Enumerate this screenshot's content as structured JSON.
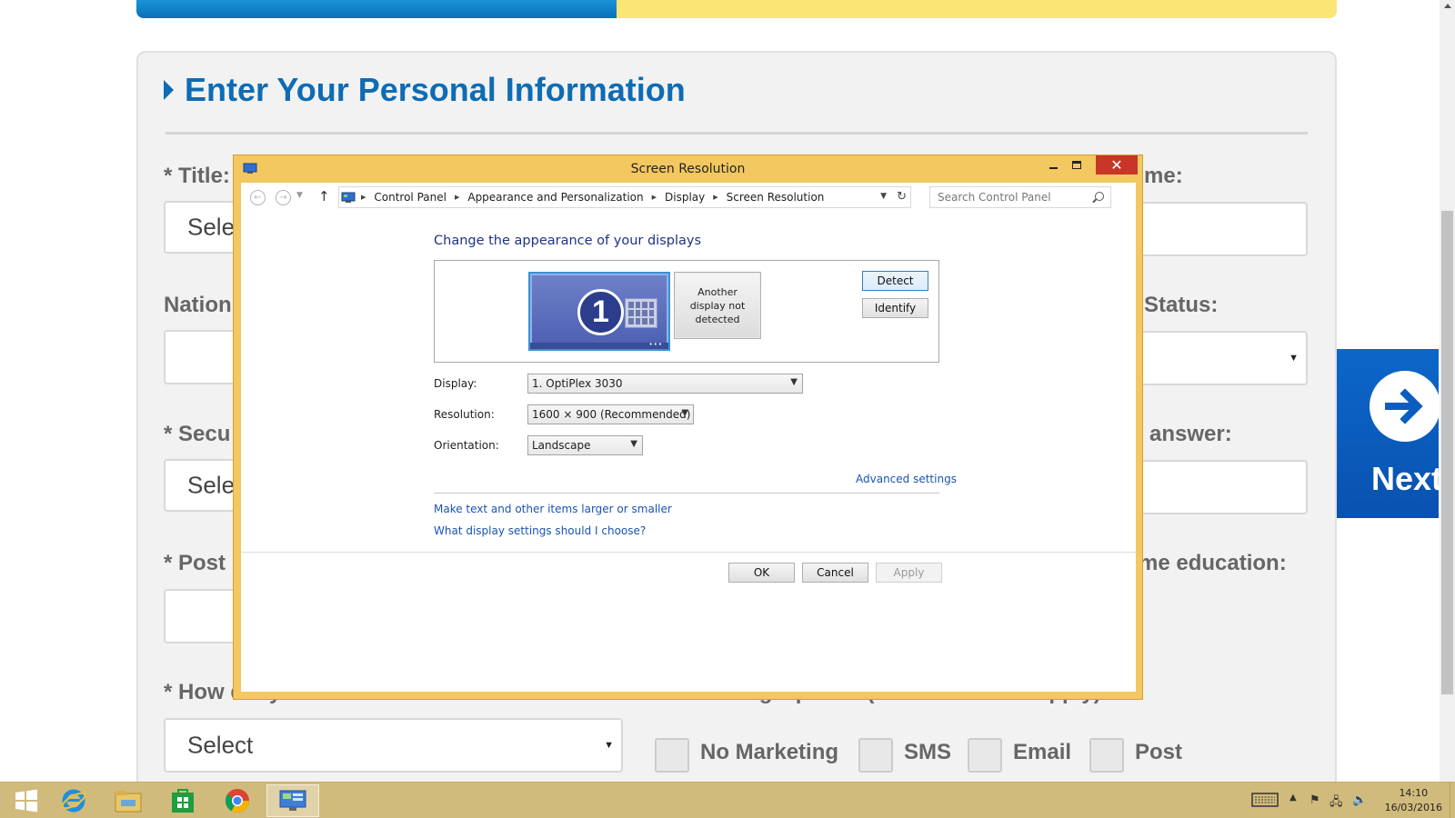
{
  "page": {
    "form": {
      "progress": 0.4,
      "section_title": "Enter Your Personal Information",
      "labels": {
        "title": "* Title:",
        "name_right": "me:",
        "nationality": "Nation",
        "status_right": "Status:",
        "security": "* Secu",
        "answer_right": "answer:",
        "post": "* Post",
        "education_right": "me education:",
        "hear": "* How did you hear about our loan?",
        "marketing": "* Marketing Options (Choose all that apply):"
      },
      "title_select": "Sele",
      "security_select": "Sele",
      "hear_select": "Select",
      "marketing_options": [
        "No Marketing",
        "SMS",
        "Email",
        "Post"
      ],
      "next_label": "Next"
    }
  },
  "dialog": {
    "title": "Screen Resolution",
    "breadcrumb": [
      "Control Panel",
      "Appearance and Personalization",
      "Display",
      "Screen Resolution"
    ],
    "search_placeholder": "Search Control Panel",
    "heading": "Change the appearance of your displays",
    "monitor1_number": "1",
    "monitor2_text": "Another display not detected",
    "detect_label": "Detect",
    "identify_label": "Identify",
    "display_label": "Display:",
    "display_value": "1. OptiPlex 3030",
    "resolution_label": "Resolution:",
    "resolution_value": "1600 × 900 (Recommended)",
    "orientation_label": "Orientation:",
    "orientation_value": "Landscape",
    "advanced_link": "Advanced settings",
    "link_text_size": "Make text and other items larger or smaller",
    "link_help": "What display settings should I choose?",
    "ok_label": "OK",
    "cancel_label": "Cancel",
    "apply_label": "Apply"
  },
  "taskbar": {
    "apps": [
      "start-icon",
      "internet-explorer-icon",
      "file-explorer-icon",
      "store-icon",
      "chrome-icon",
      "control-panel-icon"
    ],
    "clock_time": "14:10",
    "clock_date": "16/03/2016"
  },
  "colors": {
    "accent_blue": "#0d6cb4",
    "progress_yellow": "#fbe575",
    "dialog_frame": "#f3c860",
    "close_red": "#c8362a",
    "taskbar": "#d1bb7c"
  }
}
